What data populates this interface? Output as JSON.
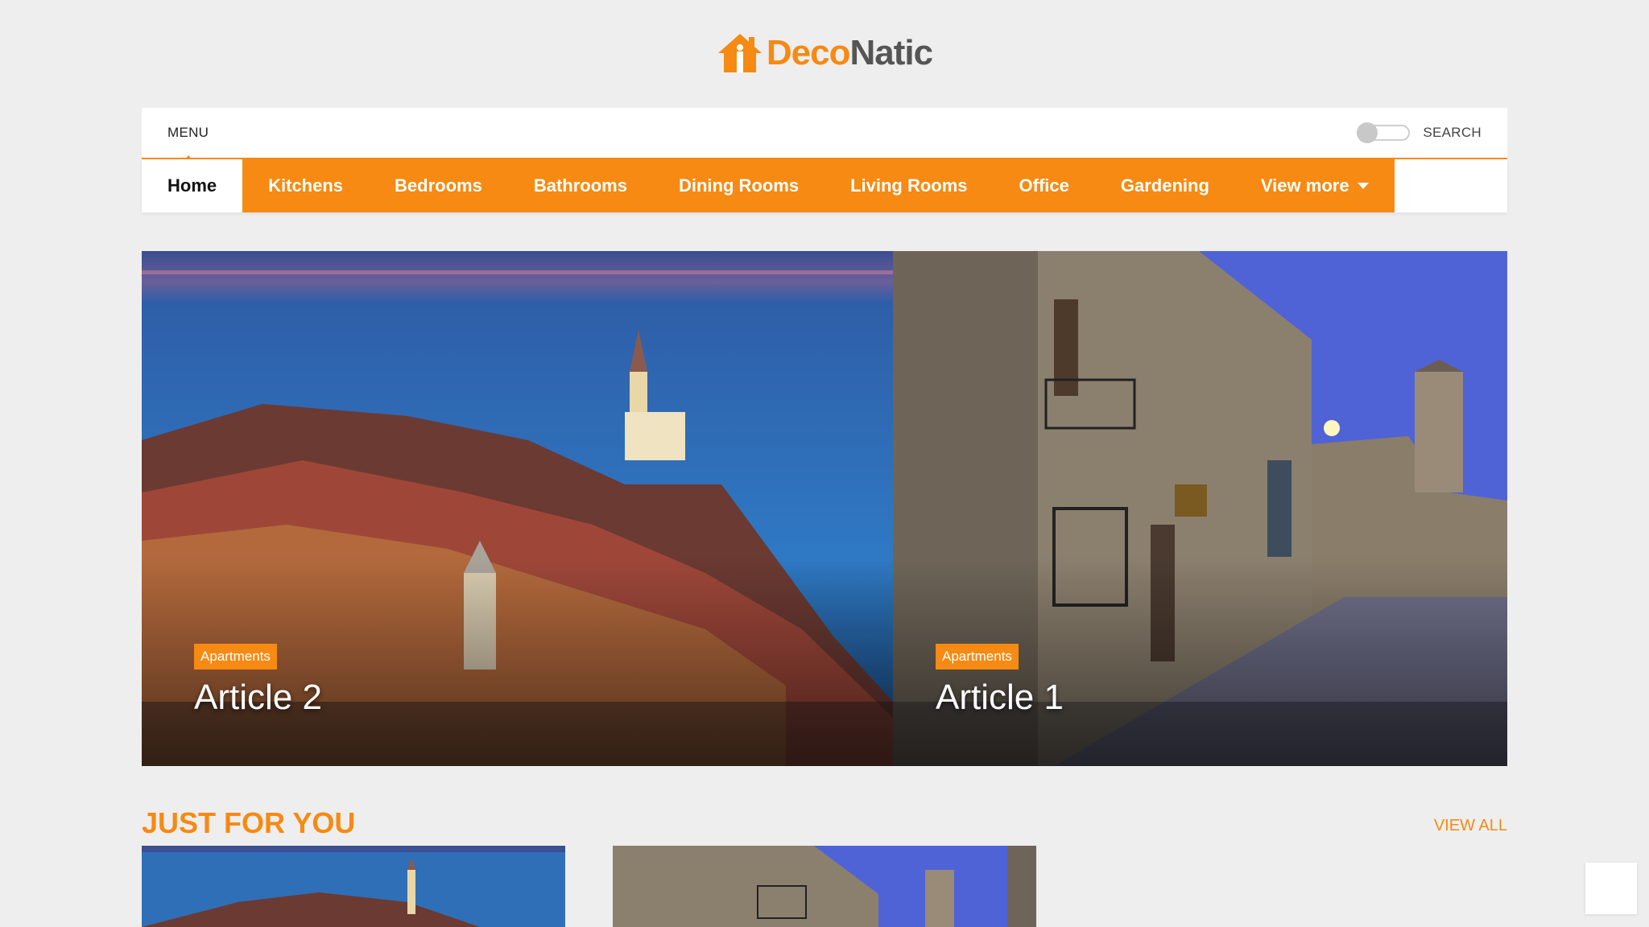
{
  "brand": {
    "name_part1": "Deco",
    "name_part2": "Natic",
    "accent": "#f68a13"
  },
  "topbar": {
    "menu_label": "MENU",
    "search_label": "SEARCH"
  },
  "nav": {
    "items": [
      {
        "label": "Home",
        "active": true
      },
      {
        "label": "Kitchens"
      },
      {
        "label": "Bedrooms"
      },
      {
        "label": "Bathrooms"
      },
      {
        "label": "Dining Rooms"
      },
      {
        "label": "Living Rooms"
      },
      {
        "label": "Office"
      },
      {
        "label": "Gardening"
      },
      {
        "label": "View more"
      }
    ]
  },
  "hero": {
    "articles": [
      {
        "category": "Apartments",
        "title": "Article 2"
      },
      {
        "category": "Apartments",
        "title": "Article 1"
      }
    ]
  },
  "section": {
    "title": "JUST FOR YOU",
    "view_all": "VIEW ALL"
  }
}
